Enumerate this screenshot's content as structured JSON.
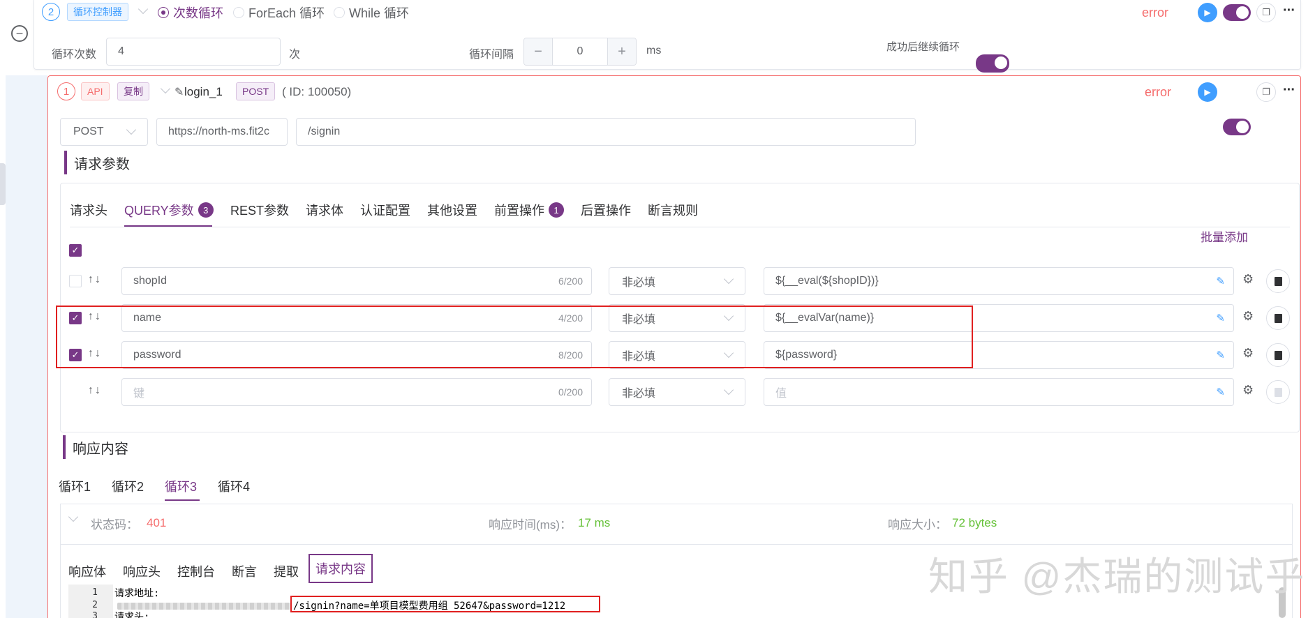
{
  "loop": {
    "index": "2",
    "tag": "循环控制器",
    "radios": [
      {
        "label": "次数循环",
        "checked": true
      },
      {
        "label": "ForEach 循环",
        "checked": false
      },
      {
        "label": "While 循环",
        "checked": false
      }
    ],
    "status": "error",
    "count_label": "循环次数",
    "count_value": "4",
    "count_unit": "次",
    "interval_label": "循环间隔",
    "interval_value": "0",
    "interval_minus": "−",
    "interval_plus": "+",
    "interval_unit": "ms",
    "continue_label": "成功后继续循环",
    "continue_on": true
  },
  "api": {
    "index": "1",
    "type_tag": "API",
    "copy_tag": "复制",
    "name": "login_1",
    "method_tag": "POST",
    "id_text": "( ID: 100050)",
    "status": "error",
    "method": "POST",
    "base_url": "https://north-ms.fit2c",
    "path": "/signin"
  },
  "request_params": {
    "title": "请求参数",
    "tabs": [
      {
        "label": "请求头",
        "badge": ""
      },
      {
        "label": "QUERY参数",
        "badge": "3",
        "active": true
      },
      {
        "label": "REST参数",
        "badge": ""
      },
      {
        "label": "请求体",
        "badge": ""
      },
      {
        "label": "认证配置",
        "badge": ""
      },
      {
        "label": "其他设置",
        "badge": ""
      },
      {
        "label": "前置操作",
        "badge": "1"
      },
      {
        "label": "后置操作",
        "badge": ""
      },
      {
        "label": "断言规则",
        "badge": ""
      }
    ],
    "batch_add": "批量添加",
    "arrows": "↑↓",
    "rows": [
      {
        "checked": false,
        "key": "shopId",
        "count": "6/200",
        "required": "非必填",
        "value": "${__eval(${shopID})}",
        "empty": false
      },
      {
        "checked": true,
        "key": "name",
        "count": "4/200",
        "required": "非必填",
        "value": "${__evalVar(name)}",
        "empty": false
      },
      {
        "checked": true,
        "key": "password",
        "count": "8/200",
        "required": "非必填",
        "value": "${password}",
        "empty": false
      },
      {
        "checked": false,
        "key": "键",
        "count": "0/200",
        "required": "非必填",
        "value": "值",
        "empty": true
      }
    ]
  },
  "response": {
    "title": "响应内容",
    "loop_tabs": [
      "循环1",
      "循环2",
      "循环3",
      "循环4"
    ],
    "active_loop": 2,
    "status_label": "状态码：",
    "status_value": "401",
    "time_label": "响应时间(ms)：",
    "time_value": "17 ms",
    "size_label": "响应大小：",
    "size_value": "72 bytes",
    "tabs": [
      "响应体",
      "响应头",
      "控制台",
      "断言",
      "提取",
      "请求内容"
    ],
    "active_tab": 5,
    "code_lines": [
      {
        "no": "1",
        "text": "请求地址:"
      },
      {
        "no": "2",
        "text": "/signin?name=单项目模型费用组_52647&password=1212"
      },
      {
        "no": "3",
        "text": "请求头:"
      }
    ]
  },
  "watermark": "知乎 @杰瑞的测试乎",
  "colors": {
    "accent": "#783887",
    "error": "#f56c6c",
    "success": "#67c23a",
    "highlight_box": "#e02020"
  }
}
